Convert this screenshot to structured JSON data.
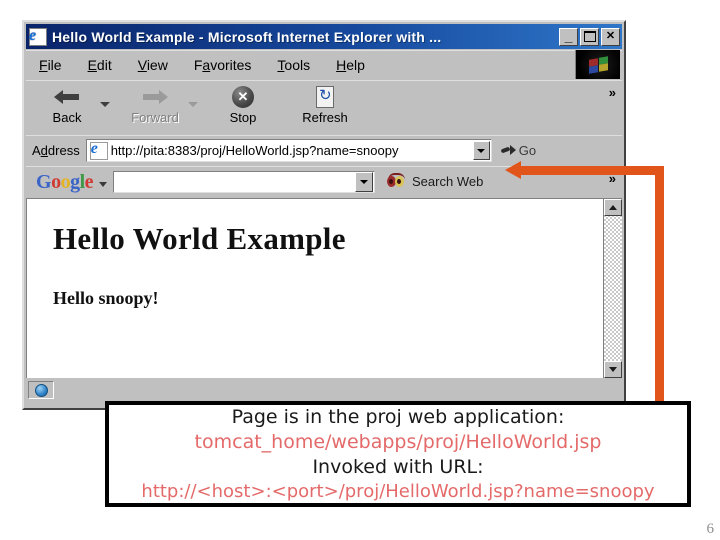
{
  "window": {
    "title": "Hello World Example - Microsoft Internet Explorer with ...",
    "icon": "ie-document-icon",
    "controls": {
      "minimize": "_",
      "maximize": "□",
      "close": "✕"
    }
  },
  "menubar": {
    "items": [
      {
        "label": "File",
        "accel": "F"
      },
      {
        "label": "Edit",
        "accel": "E"
      },
      {
        "label": "View",
        "accel": "V"
      },
      {
        "label": "Favorites",
        "accel": "a"
      },
      {
        "label": "Tools",
        "accel": "T"
      },
      {
        "label": "Help",
        "accel": "H"
      }
    ],
    "logo": "ie-windows-flag-logo"
  },
  "toolbar": {
    "back_label": "Back",
    "forward_label": "Forward",
    "stop_label": "Stop",
    "refresh_label": "Refresh",
    "stop_glyph": "✕",
    "overflow_glyph": "»"
  },
  "address_bar": {
    "label": "Address",
    "url": "http://pita:8383/proj/HelloWorld.jsp?name=snoopy",
    "go_label": "Go",
    "dropdown_glyph": "▼"
  },
  "google_bar": {
    "logo_letters": [
      {
        "ch": "G",
        "color": "blue"
      },
      {
        "ch": "o",
        "color": "red"
      },
      {
        "ch": "o",
        "color": "yellow"
      },
      {
        "ch": "g",
        "color": "blue"
      },
      {
        "ch": "l",
        "color": "green"
      },
      {
        "ch": "e",
        "color": "red"
      }
    ],
    "search_value": "",
    "search_placeholder": "",
    "search_web_label": "Search Web",
    "overflow_glyph": "»"
  },
  "page": {
    "heading": "Hello World Example",
    "body": "Hello snoopy!"
  },
  "scrollbar": {
    "up_glyph": "▲",
    "down_glyph": "▼"
  },
  "status_bar": {
    "icon": "globe-icon"
  },
  "annotation": {
    "arrow_color": "#e1551b",
    "points_to": "address-bar-url"
  },
  "caption": {
    "lines": [
      {
        "text": "Page is in the proj web application:",
        "color": "dark"
      },
      {
        "text": "tomcat_home/webapps/proj/HelloWorld.jsp",
        "color": "red"
      },
      {
        "text": "Invoked with URL:",
        "color": "dark"
      },
      {
        "text": "http://<host>:<port>/proj/HelloWorld.jsp?name=snoopy",
        "color": "red"
      }
    ]
  },
  "slide": {
    "page_number": "6"
  }
}
